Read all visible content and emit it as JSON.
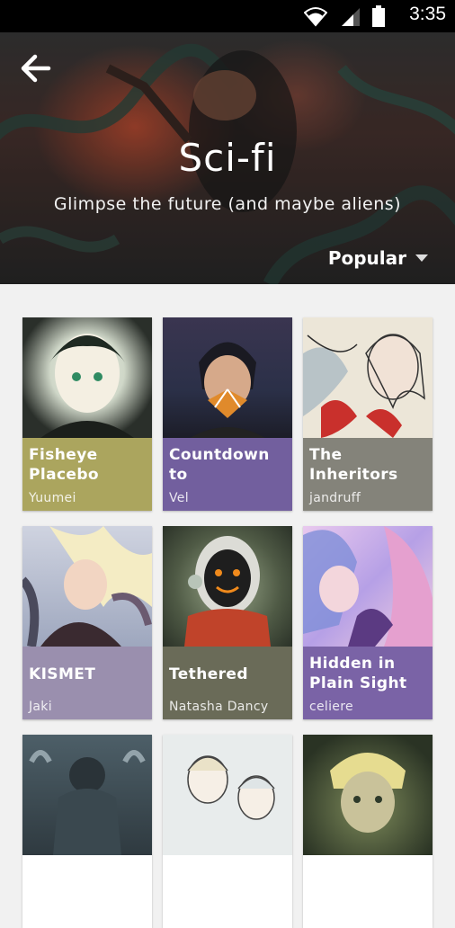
{
  "status_bar": {
    "time": "3:35",
    "icons": [
      "wifi-icon",
      "signal-icon",
      "battery-icon"
    ]
  },
  "header": {
    "back_icon": "back-arrow-icon",
    "title": "Sci-fi",
    "subtitle": "Glimpse the future (and maybe aliens)",
    "sort_label": "Popular",
    "sort_icon": "dropdown-caret-icon"
  },
  "comics": [
    {
      "title": "Fisheye Placebo",
      "author": "Yuumei",
      "color": "#aba55e"
    },
    {
      "title": "Countdown to",
      "author": "Vel",
      "color": "#725f9e"
    },
    {
      "title": "The Inheritors",
      "author": "jandruff",
      "color": "#84837a"
    },
    {
      "title": "KISMET",
      "author": "Jaki",
      "color": "#9a8fae"
    },
    {
      "title": "Tethered",
      "author": "Natasha Dancy",
      "color": "#6a6b58"
    },
    {
      "title": "Hidden in Plain Sight",
      "author": "celiere",
      "color": "#7a63a6"
    },
    {
      "title": "",
      "author": "",
      "color": "#5b6a72"
    },
    {
      "title": "",
      "author": "",
      "color": "#a3a8a8"
    },
    {
      "title": "",
      "author": "",
      "color": "#3d4a3a"
    }
  ]
}
